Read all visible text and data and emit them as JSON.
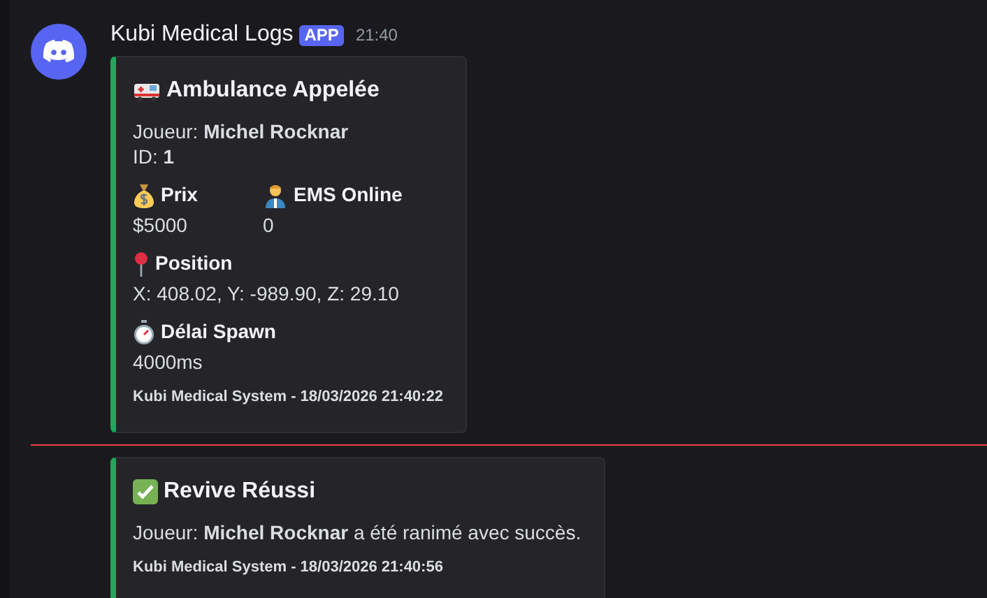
{
  "message": {
    "author": "Kubi Medical Logs",
    "badge": "APP",
    "time": "21:40"
  },
  "embeds": [
    {
      "color": "#23a55a",
      "title": "Ambulance Appelée",
      "lines": [
        "Joueur: **Michel Rocknar**",
        "ID: **1**"
      ],
      "fields": [
        {
          "name": "Prix",
          "value": "$5000",
          "inline": true
        },
        {
          "name": "EMS Online",
          "value": "0",
          "inline": true
        },
        {
          "name": "Position",
          "value": "X: 408.02, Y: -989.90, Z: 29.10",
          "inline": false
        },
        {
          "name": "Délai Spawn",
          "value": "4000ms",
          "inline": false
        }
      ],
      "footer": "Kubi Medical System - 18/03/2026 21:40:22"
    },
    {
      "color": "#23a55a",
      "title": "Revive Réussi",
      "lines": [
        "Joueur: **Michel Rocknar** a été ranimé avec succès."
      ],
      "footer": "Kubi Medical System - 18/03/2026 21:40:56"
    }
  ],
  "new_messages_divider": true
}
